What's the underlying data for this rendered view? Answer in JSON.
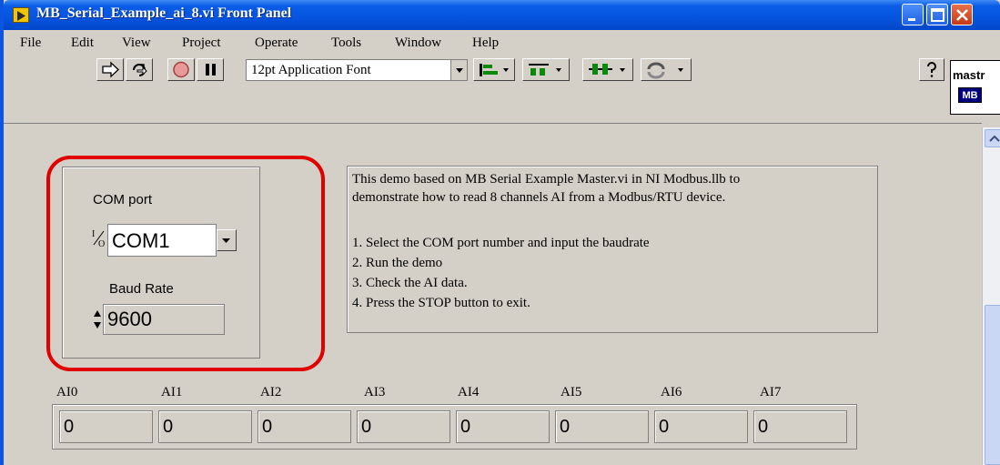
{
  "window": {
    "title": "MB_Serial_Example_ai_8.vi Front Panel"
  },
  "menu": [
    "File",
    "Edit",
    "View",
    "Project",
    "Operate",
    "Tools",
    "Window",
    "Help"
  ],
  "toolbar": {
    "font": "12pt Application Font",
    "icons": [
      "run-arrow-icon",
      "run-continuously-icon",
      "abort-icon",
      "pause-icon",
      "align-icon",
      "distribute-icon",
      "resize-icon",
      "reorder-icon",
      "help-icon"
    ]
  },
  "palette": {
    "label": "mastr",
    "badge": "MB"
  },
  "controls": {
    "com_port_label": "COM port",
    "com_port_value": "COM1",
    "io_glyph": "⅟₀",
    "baud_rate_label": "Baud Rate",
    "baud_rate_value": "9600"
  },
  "description": {
    "lines": [
      "This demo based on MB Serial Example Master.vi in NI Modbus.llb to",
      "demonstrate how to read 8 channels AI from a Modbus/RTU device.",
      "",
      "1. Select the COM port number and input the baudrate",
      "2. Run the demo",
      "3. Check the AI data.",
      "4. Press the STOP button to exit."
    ]
  },
  "ai_channels": [
    {
      "label": "AI0",
      "value": "0"
    },
    {
      "label": "AI1",
      "value": "0"
    },
    {
      "label": "AI2",
      "value": "0"
    },
    {
      "label": "AI3",
      "value": "0"
    },
    {
      "label": "AI4",
      "value": "0"
    },
    {
      "label": "AI5",
      "value": "0"
    },
    {
      "label": "AI6",
      "value": "0"
    },
    {
      "label": "AI7",
      "value": "0"
    }
  ],
  "colors": {
    "titlebar": "#0554e0",
    "panel": "#d4d0c8",
    "highlight": "#e00000"
  }
}
